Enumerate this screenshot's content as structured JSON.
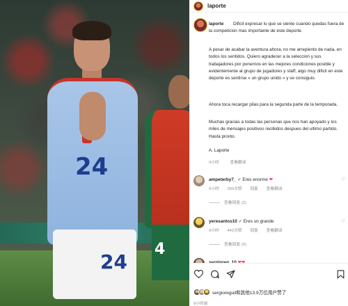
{
  "header": {
    "username": "laporte"
  },
  "post": {
    "username": "laporte",
    "caption": [
      "Dificil expresar lo que se siente cuando quedas fuera de la competicion mas importante de este deporte.",
      "A pesar de acabar la aventura ahora, no me arrepiento de nada, en todos los sentidos. Quiero agradecer a la seleccion y sus trabajadores por ponernos en las mejores condiciones posible y evidentemente al grupo de jugadores y staff, algo muy dificil en este deporte es sentirse « un grupo unido » y se consiguio.",
      "Ahora toca recargar pilas para la segunda parte de la temporada.",
      "Muchas gracias a todas las personas que nos han apoyado y los miles de mensajes positivos recibidos despues del ultimo partido. Hasta pronto.",
      "A. Laporte"
    ],
    "time_ago": "9小时",
    "see_translation": "查看翻译"
  },
  "comments": [
    {
      "username": "ampeterby7_",
      "text": "Eres enorme",
      "emoji": "❤",
      "time_ago": "9小时",
      "likes": "260次赞",
      "reply": "回复",
      "see_translation": "查看翻译",
      "view_replies": "查看回复 (2)"
    },
    {
      "username": "yeresantos10",
      "text": "Eres un grande",
      "time_ago": "9小时",
      "likes": "442次赞",
      "reply": "回复",
      "see_translation": "查看翻译",
      "view_replies": "查看回复 (5)"
    },
    {
      "username": "sergioreg_10",
      "text": "❤❤"
    }
  ],
  "footer": {
    "likes_text": "sergioreguil和其他13.9万位用户赞了",
    "time_ago": "9小时前"
  },
  "colors": {
    "verified": "#3897f0",
    "heart": "#ed4956",
    "muted": "#8e8e8e"
  }
}
